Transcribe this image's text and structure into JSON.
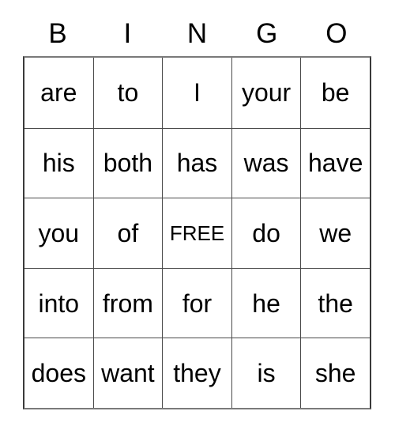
{
  "card": {
    "headers": [
      "B",
      "I",
      "N",
      "G",
      "O"
    ],
    "rows": [
      [
        "are",
        "to",
        "I",
        "your",
        "be"
      ],
      [
        "his",
        "both",
        "has",
        "was",
        "have"
      ],
      [
        "you",
        "of",
        "FREE",
        "do",
        "we"
      ],
      [
        "into",
        "from",
        "for",
        "he",
        "the"
      ],
      [
        "does",
        "want",
        "they",
        "is",
        "she"
      ]
    ],
    "free_space": {
      "label": "FREE",
      "row": 2,
      "col": 2
    },
    "colors": {
      "background": "#ffffff",
      "text": "#000000",
      "grid_line": "#4a4a4a",
      "outer_border": "#7a7a7a"
    }
  }
}
